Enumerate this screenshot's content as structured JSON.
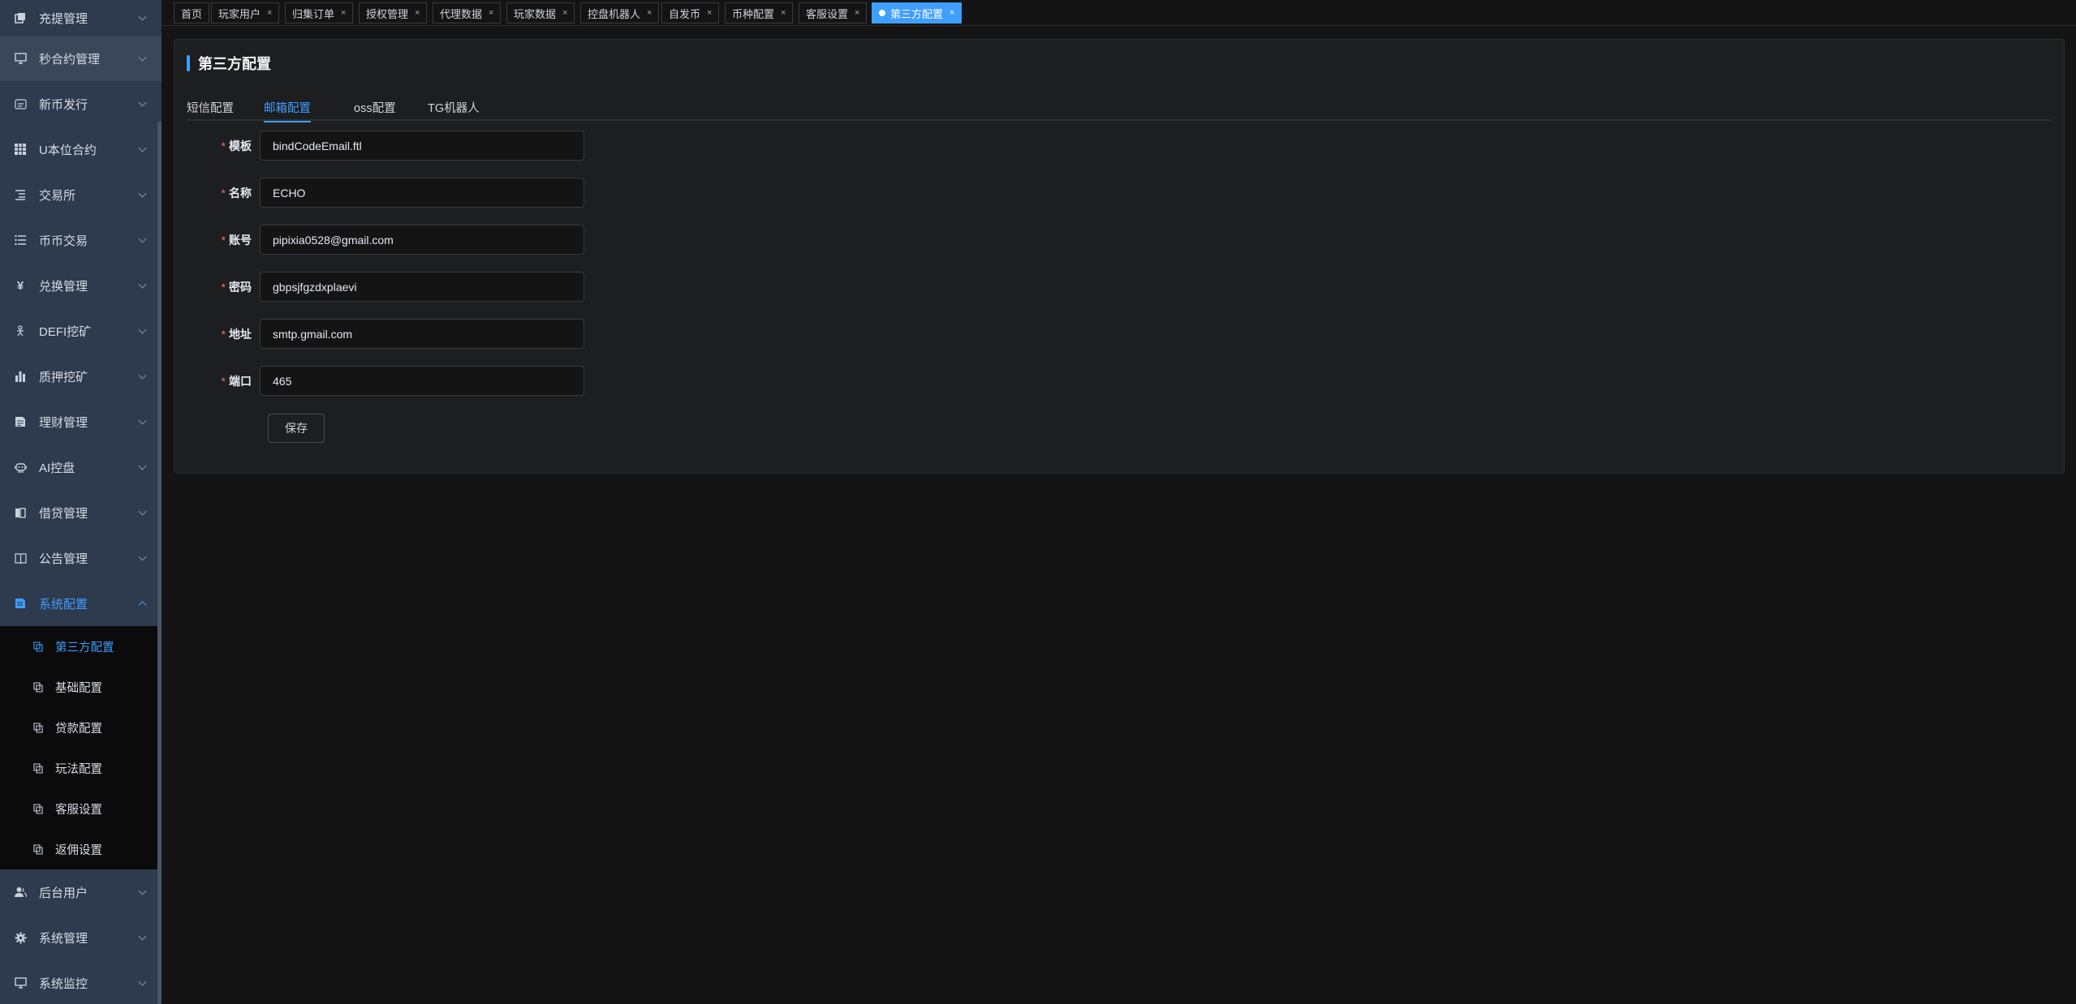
{
  "sidebar": {
    "items": [
      {
        "label": "充提管理",
        "icon": "wallet-icon"
      },
      {
        "label": "秒合约管理",
        "icon": "monitor-icon"
      },
      {
        "label": "新币发行",
        "icon": "coin-icon"
      },
      {
        "label": "U本位合约",
        "icon": "grid-icon"
      },
      {
        "label": "交易所",
        "icon": "list-icon"
      },
      {
        "label": "币币交易",
        "icon": "list-icon"
      },
      {
        "label": "兑换管理",
        "icon": "yen-icon"
      },
      {
        "label": "DEFI挖矿",
        "icon": "miner-icon"
      },
      {
        "label": "质押挖矿",
        "icon": "bar-chart-icon"
      },
      {
        "label": "理财管理",
        "icon": "document-icon"
      },
      {
        "label": "AI控盘",
        "icon": "robot-icon"
      },
      {
        "label": "借贷管理",
        "icon": "loan-icon"
      },
      {
        "label": "公告管理",
        "icon": "book-icon"
      },
      {
        "label": "系统配置",
        "icon": "settings-doc-icon"
      }
    ],
    "subitems": [
      {
        "label": "第三方配置"
      },
      {
        "label": "基础配置"
      },
      {
        "label": "贷款配置"
      },
      {
        "label": "玩法配置"
      },
      {
        "label": "客服设置"
      },
      {
        "label": "返佣设置"
      }
    ],
    "bottom_items": [
      {
        "label": "后台用户",
        "icon": "user-icon"
      },
      {
        "label": "系统管理",
        "icon": "gear-icon"
      },
      {
        "label": "系统监控",
        "icon": "monitor-icon"
      }
    ]
  },
  "tags": [
    {
      "label": "首页"
    },
    {
      "label": "玩家用户",
      "close": "×"
    },
    {
      "label": "归集订单",
      "close": "×"
    },
    {
      "label": "授权管理",
      "close": "×"
    },
    {
      "label": "代理数据",
      "close": "×"
    },
    {
      "label": "玩家数据",
      "close": "×"
    },
    {
      "label": "控盘机器人",
      "close": "×"
    },
    {
      "label": "自发币",
      "close": "×"
    },
    {
      "label": "币种配置",
      "close": "×"
    },
    {
      "label": "客服设置",
      "close": "×"
    },
    {
      "label": "第三方配置",
      "close": "×"
    }
  ],
  "card": {
    "title": "第三方配置",
    "tabs": [
      {
        "label": "短信配置"
      },
      {
        "label": "邮箱配置"
      },
      {
        "label": "oss配置"
      },
      {
        "label": "TG机器人"
      }
    ],
    "fields": [
      {
        "required": "*",
        "label": "模板",
        "value": "bindCodeEmail.ftl"
      },
      {
        "required": "*",
        "label": "名称",
        "value": "ECHO"
      },
      {
        "required": "*",
        "label": "账号",
        "value": "pipixia0528@gmail.com"
      },
      {
        "required": "*",
        "label": "密码",
        "value": "gbpsjfgzdxplaevi"
      },
      {
        "required": "*",
        "label": "地址",
        "value": "smtp.gmail.com"
      },
      {
        "required": "*",
        "label": "端口",
        "value": "465"
      }
    ],
    "save_label": "保存"
  },
  "colors": {
    "accent": "#409eff",
    "sidebar_bg": "#2e3a4d",
    "required": "#f56c6c"
  }
}
